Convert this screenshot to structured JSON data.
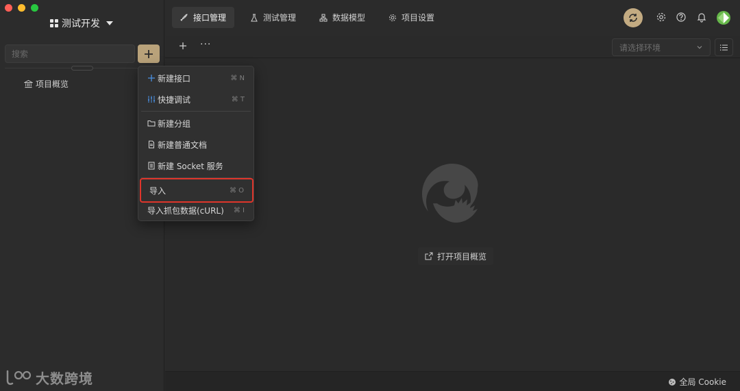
{
  "sidebar": {
    "project_name": "测试开发",
    "search_placeholder": "搜索",
    "tree": [
      {
        "label": "项目概览",
        "icon": "bank-icon"
      }
    ],
    "brand": "大数跨境"
  },
  "tabs": [
    {
      "label": "接口管理",
      "icon": "rocket-icon",
      "active": true
    },
    {
      "label": "测试管理",
      "icon": "flask-icon",
      "active": false
    },
    {
      "label": "数据模型",
      "icon": "hierarchy-icon",
      "active": false
    },
    {
      "label": "项目设置",
      "icon": "gear-icon",
      "active": false
    }
  ],
  "toolbar": {
    "more_label": "···",
    "env_placeholder": "请选择环境"
  },
  "menu": {
    "items": [
      {
        "label": "新建接口",
        "shortcut": "⌘ N",
        "icon": "plus-icon"
      },
      {
        "label": "快捷调试",
        "shortcut": "⌘ T",
        "icon": "sliders-icon"
      },
      {
        "label": "新建分组",
        "shortcut": "",
        "icon": "folder-icon"
      },
      {
        "label": "新建普通文档",
        "shortcut": "",
        "icon": "document-icon"
      },
      {
        "label": "新建 Socket 服务",
        "shortcut": "",
        "icon": "socket-icon"
      },
      {
        "label": "导入",
        "shortcut": "⌘ O",
        "icon": "",
        "highlighted": true
      },
      {
        "label": "导入抓包数据(cURL)",
        "shortcut": "⌘ I",
        "icon": ""
      }
    ]
  },
  "main": {
    "open_overview": "打开项目概览"
  },
  "statusbar": {
    "cookie": "全局 Cookie"
  },
  "colors": {
    "accent_gold": "#b9a27a",
    "highlight_red": "#e0352b",
    "menu_blue": "#4a90e2",
    "avatar_green": "#66b74a"
  }
}
